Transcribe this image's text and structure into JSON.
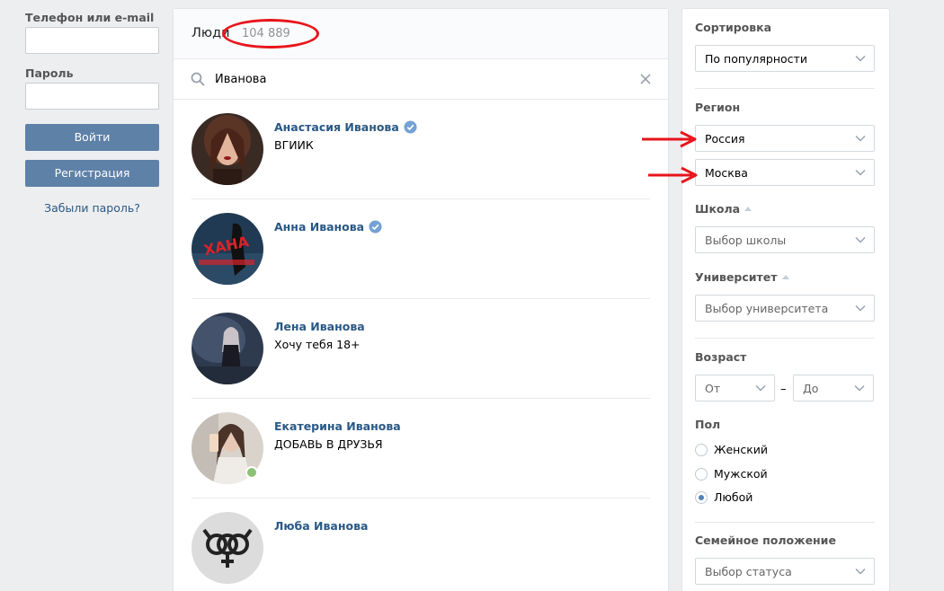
{
  "login": {
    "phone_label": "Телефон или e-mail",
    "password_label": "Пароль",
    "login_button": "Войти",
    "register_button": "Регистрация",
    "forgot_link": "Забыли пароль?"
  },
  "main": {
    "title": "Люди",
    "count": "104 889",
    "search_value": "Иванова",
    "people": [
      {
        "name": "Анастасия Иванова",
        "status": "ВГИИК",
        "verified": true,
        "online": false
      },
      {
        "name": "Анна Иванова",
        "status": "",
        "verified": true,
        "online": false
      },
      {
        "name": "Лена Иванова",
        "status": "Хочу тебя 18+",
        "verified": false,
        "online": false
      },
      {
        "name": "Екатерина Иванова",
        "status": "ДОБАВЬ В ДРУЗЬЯ",
        "verified": false,
        "online": true
      },
      {
        "name": "Люба Иванова",
        "status": "",
        "verified": false,
        "online": false
      }
    ]
  },
  "filters": {
    "sort_label": "Сортировка",
    "sort_value": "По популярности",
    "region_label": "Регион",
    "country_value": "Россия",
    "city_value": "Москва",
    "school_label": "Школа",
    "school_placeholder": "Выбор школы",
    "university_label": "Университет",
    "university_placeholder": "Выбор университета",
    "age_label": "Возраст",
    "age_from": "От",
    "age_to": "До",
    "age_dash": "–",
    "gender_label": "Пол",
    "gender_options": [
      "Женский",
      "Мужской",
      "Любой"
    ],
    "gender_selected": "Любой",
    "marital_label": "Семейное положение",
    "marital_placeholder": "Выбор статуса"
  },
  "colors": {
    "link": "#2a5885",
    "button": "#5e81a8",
    "annotation": "#e8141b",
    "online": "#8ac176",
    "verified": "#5181b8"
  }
}
